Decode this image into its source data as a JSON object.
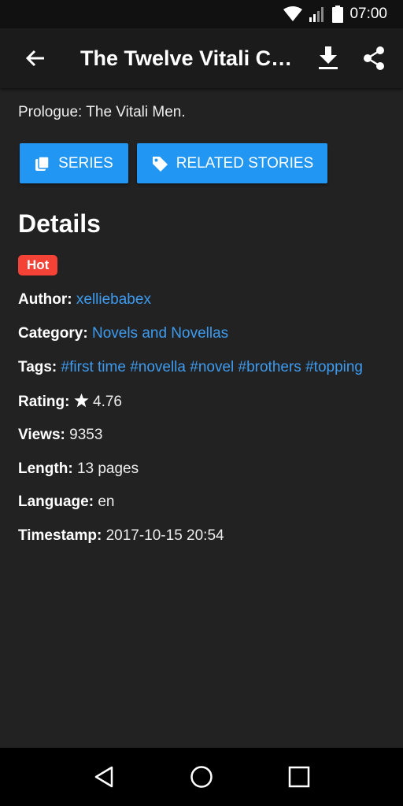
{
  "status_bar": {
    "time": "07:00",
    "icons": [
      "wifi-icon",
      "signal-icon",
      "battery-icon"
    ]
  },
  "app_bar": {
    "title": "The Twelve Vitali C…",
    "back_icon": "back-arrow-icon",
    "download_icon": "download-icon",
    "share_icon": "share-icon"
  },
  "story": {
    "prologue": "Prologue: The Vitali Men."
  },
  "buttons": {
    "series_label": "SERIES",
    "series_icon": "copy-icon",
    "related_label": "RELATED STORIES",
    "related_icon": "tag-icon"
  },
  "details": {
    "heading": "Details",
    "badge": "Hot",
    "author": {
      "label": "Author:",
      "value": "xelliebabex"
    },
    "category": {
      "label": "Category:",
      "value": "Novels and Novellas"
    },
    "tags": {
      "label": "Tags:",
      "values": [
        "#first time",
        "#novella",
        "#novel",
        "#brothers",
        "#topping"
      ]
    },
    "rating": {
      "label": "Rating:",
      "value": "4.76",
      "icon": "star-icon"
    },
    "views": {
      "label": "Views:",
      "value": "9353"
    },
    "length": {
      "label": "Length:",
      "value": "13 pages"
    },
    "language": {
      "label": "Language:",
      "value": "en"
    },
    "timestamp": {
      "label": "Timestamp:",
      "value": "2017-10-15 20:54"
    }
  },
  "colors": {
    "accent": "#2196f3",
    "link": "#3d9bf0",
    "badge": "#f44336",
    "background": "#222222"
  },
  "nav_bar": {
    "icons": [
      "back-triangle-icon",
      "home-circle-icon",
      "recents-square-icon"
    ]
  }
}
